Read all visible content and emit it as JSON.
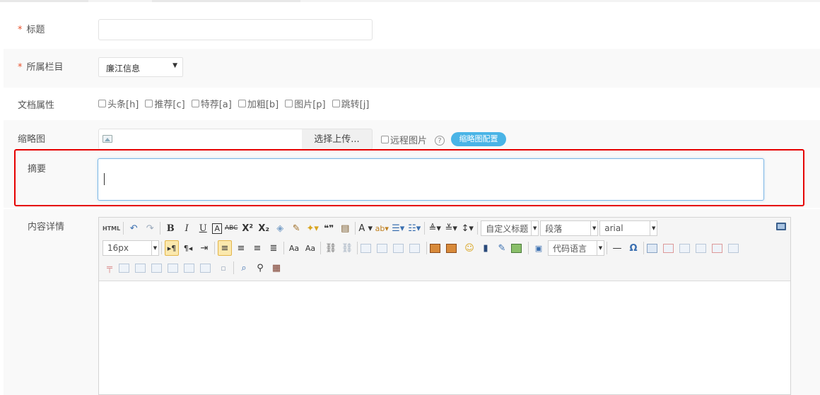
{
  "form": {
    "title_label": "标题",
    "title_value": "",
    "category_label": "所属栏目",
    "category_value": "廉江信息",
    "category_arrow": "▼",
    "attributes_label": "文档属性",
    "attributes": [
      "头条[h]",
      "推荐[c]",
      "特荐[a]",
      "加粗[b]",
      "图片[p]",
      "跳转[j]"
    ],
    "thumb_label": "缩略图",
    "thumb_upload_button": "选择上传...",
    "thumb_remote_label": "远程图片",
    "thumb_help": "?",
    "thumb_config_button": "缩略图配置",
    "summary_label": "摘要",
    "summary_value": "",
    "content_label": "内容详情",
    "required_mark": "*"
  },
  "editor": {
    "html_button": "HTML",
    "bold": "B",
    "italic": "I",
    "underline": "U",
    "strikethrough": "ABC",
    "superscript": "X²",
    "subscript": "X₂",
    "blockquote": "❝❞",
    "font_color": "A",
    "heading_select": "自定义标题",
    "paragraph_select": "段落",
    "font_family_select": "arial",
    "font_size_select": "16px",
    "code_language_select": "代码语言",
    "omega": "Ω",
    "horizontal_rule": "—"
  },
  "colors": {
    "required": "#e8542f",
    "highlight_border": "#e60000",
    "config_pill": "#4ab4e6",
    "focus_border": "#7fb8e6"
  }
}
